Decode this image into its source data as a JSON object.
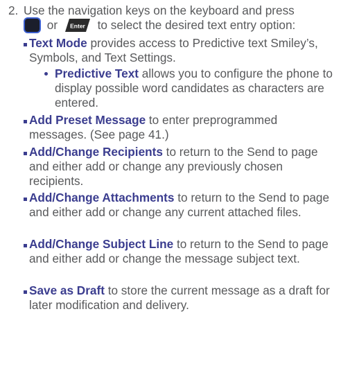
{
  "step": {
    "number": "2.",
    "text_before": "Use the navigation keys on the keyboard and press",
    "or_word": "or",
    "enter_key_label": "Enter",
    "text_after": "to select the desired text entry option:"
  },
  "options": [
    {
      "title": "Text Mode",
      "desc": " provides access to Predictive text Smiley’s, Symbols, and Text Settings.",
      "sub": {
        "title": "Predictive Text",
        "desc": " allows you to configure the phone to display possible word candidates as characters are entered."
      }
    },
    {
      "title": "Add Preset Message",
      "desc": " to enter preprogrammed messages. (See page 41.)"
    },
    {
      "title": "Add/Change Recipients",
      "desc": " to return to the Send to page and either add or change any previously chosen recipients."
    },
    {
      "title": "Add/Change Attachments",
      "desc": " to return to the Send to page and either add or change any current attached files."
    },
    {
      "title": "Add/Change Subject Line",
      "desc": " to return to the Send to page and either add or change the message subject text."
    },
    {
      "title": "Save as Draft",
      "desc": " to store the current message as a draft for later modification and delivery."
    }
  ],
  "colors": {
    "body_text": "#58595b",
    "option_title": "#3b3d8f",
    "nav_key_fill": "#1b1e2c",
    "nav_key_border": "#3b5fd0",
    "enter_key_fill": "#2b2b2b"
  },
  "icons": [
    "nav-center-key-icon",
    "enter-key-icon"
  ]
}
